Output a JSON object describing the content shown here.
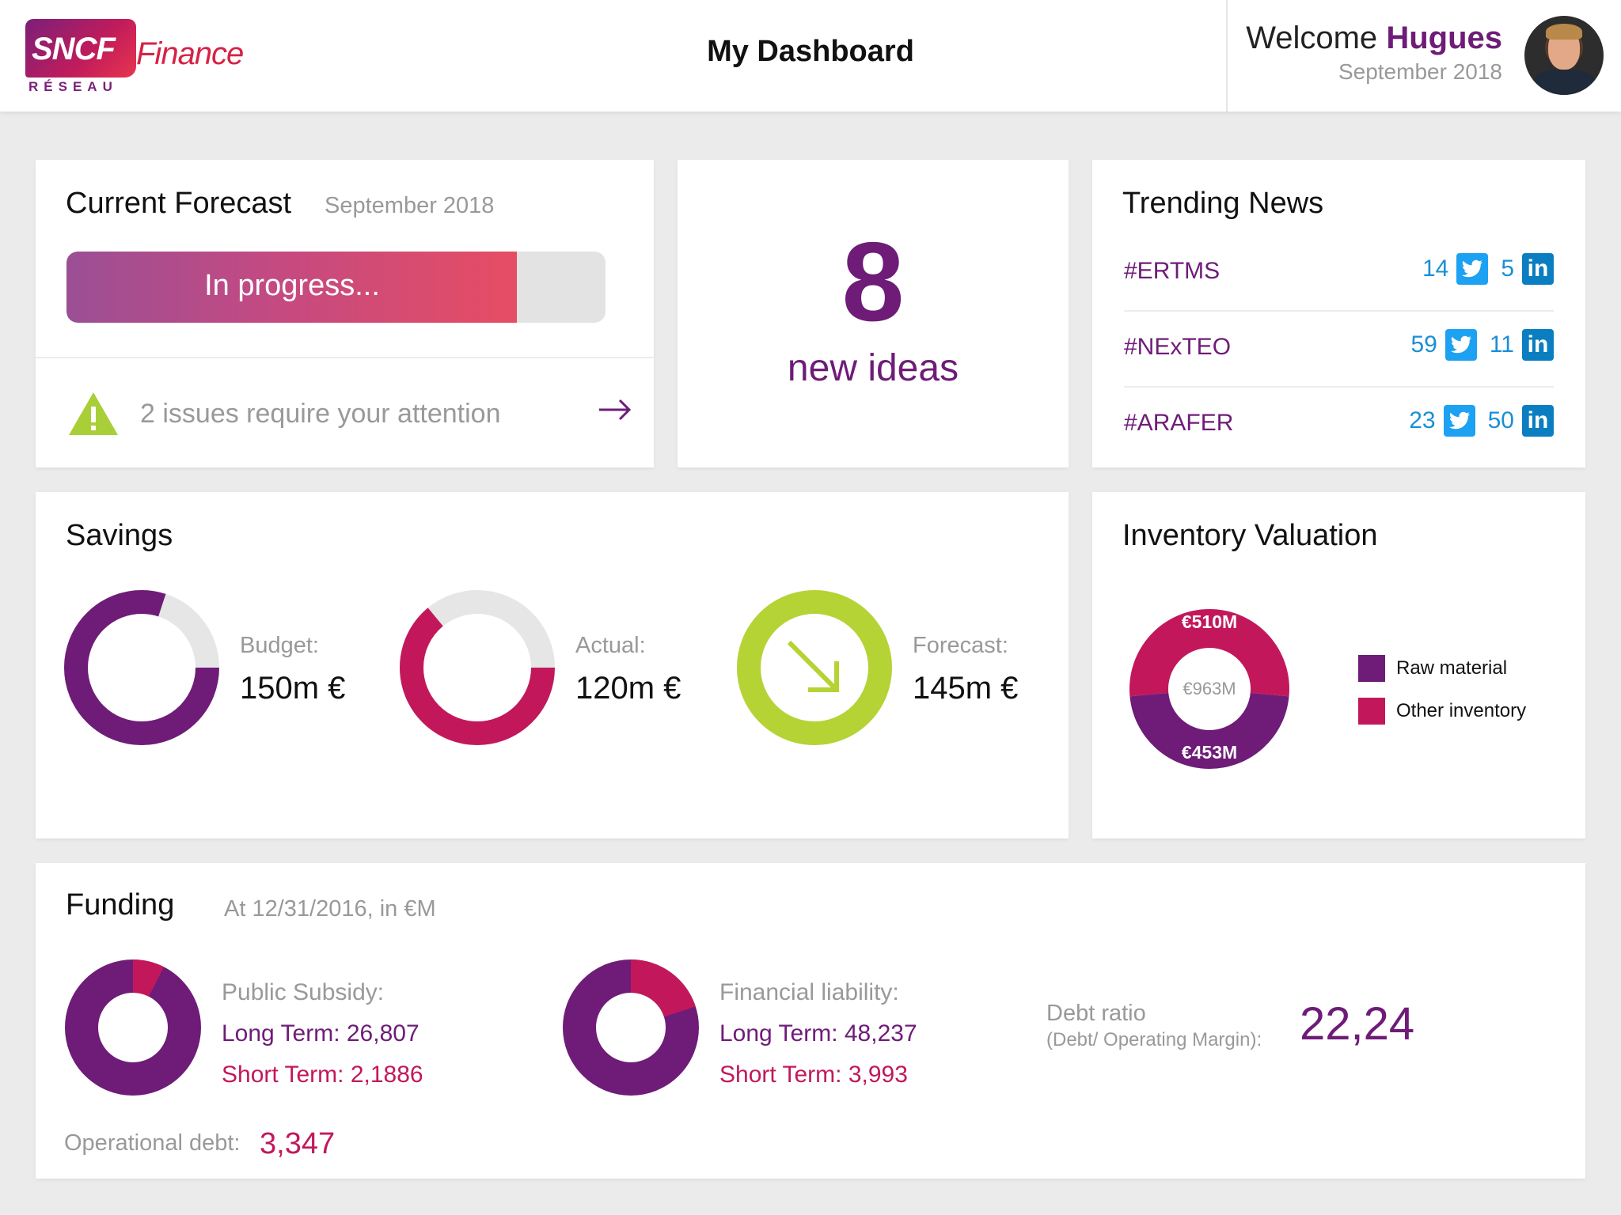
{
  "header": {
    "logo": {
      "brand": "SNCF",
      "product": "Finance",
      "division": "RÉSEAU"
    },
    "title": "My Dashboard",
    "welcome_prefix": "Welcome",
    "user_name": "Hugues",
    "date": "September 2018"
  },
  "forecast": {
    "title": "Current Forecast",
    "date": "September 2018",
    "status": "In progress...",
    "progress_fraction": 0.835,
    "issues_text": "2 issues require your attention",
    "warning_color": "#a8cf38",
    "icons": [
      "warning-icon",
      "arrow-right-icon"
    ]
  },
  "ideas": {
    "count": "8",
    "label": "new ideas"
  },
  "news": {
    "title": "Trending News",
    "items": [
      {
        "tag": "#ERTMS",
        "twitter": "14",
        "linkedin": "5"
      },
      {
        "tag": "#NExTEO",
        "twitter": "59",
        "linkedin": "11"
      },
      {
        "tag": "#ARAFER",
        "twitter": "23",
        "linkedin": "50"
      }
    ],
    "linkedin_glyph": "in"
  },
  "savings": {
    "title": "Savings",
    "items": [
      {
        "label": "Budget:",
        "value": "150m €",
        "fraction": 0.8,
        "color": "#6e1c78"
      },
      {
        "label": "Actual:",
        "value": "120m €",
        "fraction": 0.64,
        "color": "#c2185b"
      },
      {
        "label": "Forecast:",
        "value": "145m €",
        "fraction": 1.0,
        "color": "#b5d334",
        "icon": "arrow-down-right-icon"
      }
    ]
  },
  "inventory": {
    "title": "Inventory Valuation",
    "total": "€963M",
    "segments": [
      {
        "name": "Raw material",
        "value_label": "€453M",
        "value": 453,
        "color": "#6e1c78"
      },
      {
        "name": "Other inventory",
        "value_label": "€510M",
        "value": 510,
        "color": "#c2185b"
      }
    ]
  },
  "funding": {
    "title": "Funding",
    "subtitle": "At 12/31/2016, in €M",
    "groups": [
      {
        "head": "Public Subsidy:",
        "long": "Long Term: 26,807",
        "short": "Short Term: 2,1886",
        "short_fraction": 0.075
      },
      {
        "head": "Financial liability:",
        "long": "Long Term: 48,237",
        "short": "Short Term: 3,993",
        "short_fraction": 0.2
      }
    ],
    "debt_ratio_label": "Debt ratio",
    "debt_ratio_sub": "(Debt/ Operating Margin):",
    "debt_ratio_value": "22,24",
    "operational_debt_label": "Operational debt:",
    "operational_debt_value": "3,347",
    "colors": {
      "long": "#6e1c78",
      "short": "#c2185b"
    }
  },
  "colors": {
    "purple": "#6e1c78",
    "crimson": "#c2185b",
    "lime": "#b5d334",
    "twitter": "#1da1f2",
    "linkedin": "#0a7ec0"
  }
}
